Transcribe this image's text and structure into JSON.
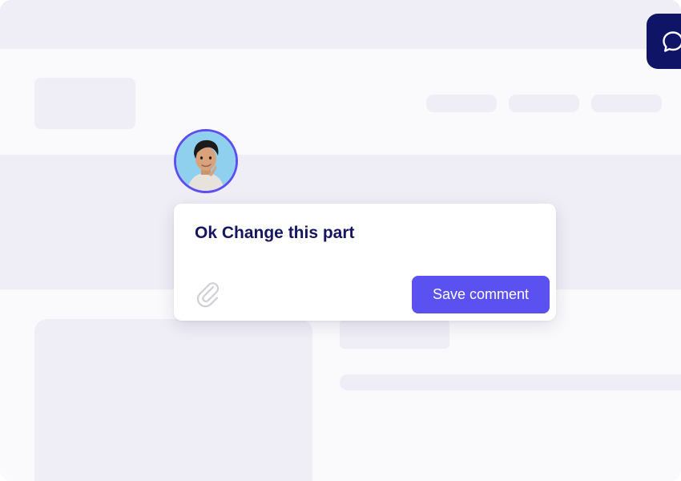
{
  "comment": {
    "text": "Ok Change this part",
    "save_label": "Save comment"
  },
  "icons": {
    "chat": "chat-bubble-icon",
    "attachment": "paperclip-icon",
    "avatar": "user-avatar"
  },
  "colors": {
    "accent": "#5b50f0",
    "fab": "#0f1466",
    "text": "#161560",
    "placeholder": "#efedf5",
    "surface": "#fafafc"
  }
}
